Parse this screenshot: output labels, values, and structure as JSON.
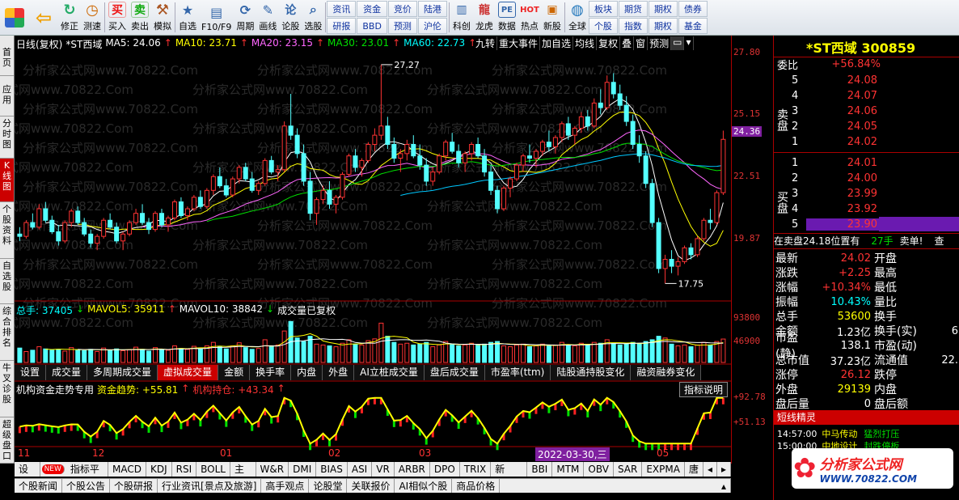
{
  "toolbar": {
    "items": [
      {
        "name": "home",
        "label": ""
      },
      {
        "name": "back",
        "label": ""
      },
      {
        "name": "fix",
        "label": "修正"
      },
      {
        "name": "test",
        "label": "测速"
      },
      {
        "name": "buy",
        "label": "买入",
        "glyph": "买"
      },
      {
        "name": "sell",
        "label": "卖出",
        "glyph": "卖"
      },
      {
        "name": "sim",
        "label": "模拟"
      },
      {
        "name": "self",
        "label": "自选"
      },
      {
        "name": "f10",
        "label": "F10/F9"
      },
      {
        "name": "period",
        "label": "周期"
      },
      {
        "name": "draw",
        "label": "画线"
      },
      {
        "name": "stock",
        "label": "论股"
      },
      {
        "name": "pick",
        "label": "选股"
      }
    ],
    "grid1": [
      "资讯",
      "研报",
      "资金",
      "BBD",
      "竞价",
      "预测",
      "陆港",
      "沪伦"
    ],
    "items2": [
      {
        "name": "kechuang",
        "label": "科创"
      },
      {
        "name": "longhu",
        "label": "龙虎"
      },
      {
        "name": "data",
        "label": "数据"
      },
      {
        "name": "hot",
        "label": "热点"
      },
      {
        "name": "newstock",
        "label": "新股"
      },
      {
        "name": "global",
        "label": "全球"
      }
    ],
    "grid2": [
      "板块",
      "个股",
      "期货",
      "指数",
      "期权",
      "期权",
      "债券",
      "基金"
    ]
  },
  "leftnav": [
    "首页",
    "应用",
    "分时图",
    "K线图",
    "个股资料",
    "自选股",
    "综合排名",
    "牛叉诊股",
    "超级盘口"
  ],
  "chart_header": {
    "period": "日线(复权)",
    "name": "*ST西域",
    "ma5": "MA5: 24.06",
    "ma10": "MA10: 23.71",
    "ma20": "MA20: 23.15",
    "ma30": "MA30: 23.01",
    "ma60": "MA60: 22.73",
    "buttons": [
      "九转",
      "重大事件",
      "加自选",
      "均线",
      "复权",
      "叠",
      "窗",
      "预测"
    ]
  },
  "price_axis": [
    "27.80",
    "25.15",
    "24.36",
    "22.51",
    "19.87"
  ],
  "price_high_label": "27.27",
  "price_low_label": "17.75",
  "volume_header": {
    "total": "总手: 37405",
    "mavol5": "MAVOL5: 35911",
    "mavol10": "MAVOL10: 38842",
    "note": "成交量已复权"
  },
  "volume_axis": [
    "93800",
    "46900"
  ],
  "subtabs": [
    "设置",
    "成交量",
    "多周期成交量",
    "虚拟成交量",
    "金额",
    "换手率",
    "内盘",
    "外盘",
    "AI立桩成交量",
    "盘后成交量",
    "市盈率(ttm)",
    "陆股通持股变化",
    "融资融券变化"
  ],
  "fund_header": {
    "title": "机构资金走势专用",
    "trend": "资金趋势: +55.81",
    "hold": "机构持仓: +43.34",
    "btn": "指标说明"
  },
  "fund_axis": [
    "+92.78",
    "+51.13"
  ],
  "x_axis": [
    "11",
    "12",
    "01",
    "02",
    "03",
    "2022-03-30,三",
    "05"
  ],
  "indicator_tabs": [
    "设置",
    "NEW",
    "指标平台",
    "MACD",
    "KDJ",
    "RSI",
    "BOLL",
    "主力",
    "W&R",
    "DMI",
    "BIAS",
    "ASI",
    "VR",
    "ARBR",
    "DPO",
    "TRIX",
    "新DMA",
    "BBI",
    "MTM",
    "OBV",
    "SAR",
    "EXPMA",
    "唐"
  ],
  "news_tabs": [
    "个股新闻",
    "个股公告",
    "个股研报",
    "行业资讯[景点及旅游]",
    "高手观点",
    "论股堂",
    "关联报价",
    "AI相似个股",
    "商品价格"
  ],
  "quote": {
    "title": "*ST西域 300859",
    "weibi_label": "委比",
    "weibi": "+56.84%",
    "sell_label": "卖盘",
    "buy_label": "买盘",
    "asks": [
      {
        "lvl": "5",
        "price": "24.08"
      },
      {
        "lvl": "4",
        "price": "24.07"
      },
      {
        "lvl": "3",
        "price": "24.06"
      },
      {
        "lvl": "2",
        "price": "24.05"
      },
      {
        "lvl": "1",
        "price": "24.02"
      }
    ],
    "bids": [
      {
        "lvl": "1",
        "price": "24.01"
      },
      {
        "lvl": "2",
        "price": "24.00"
      },
      {
        "lvl": "3",
        "price": "23.99"
      },
      {
        "lvl": "4",
        "price": "23.92"
      },
      {
        "lvl": "5",
        "price": "23.90"
      }
    ],
    "note": "在卖盘24.18位置有",
    "note_qty": "27手",
    "note_tag": "卖单!",
    "note_btn": "查",
    "stats": [
      {
        "l": "最新",
        "v": "24.02",
        "l2": "开盘"
      },
      {
        "l": "涨跌",
        "v": "+2.25",
        "l2": "最高"
      },
      {
        "l": "涨幅",
        "v": "+10.34%",
        "l2": "最低"
      },
      {
        "l": "振幅",
        "v": "10.43%",
        "l2": "量比"
      },
      {
        "l": "总手",
        "v": "53600",
        "l2": "换手"
      },
      {
        "l": "金额",
        "v": "1.23亿",
        "l2": "换手(实)"
      },
      {
        "l": "市盈(静)",
        "v": "138.1",
        "l2": "市盈(动)"
      },
      {
        "l": "总市值",
        "v": "37.23亿",
        "l2": "流通值"
      },
      {
        "l": "涨停",
        "v": "26.12",
        "l2": "跌停"
      },
      {
        "l": "外盘",
        "v": "29139",
        "l2": "内盘"
      },
      {
        "l": "盘后量",
        "v": "0",
        "l2": "盘后额"
      }
    ],
    "stats_right_tail": [
      "",
      "",
      "",
      "",
      "",
      "6",
      "",
      "22.",
      "",
      "",
      ""
    ],
    "sprite_title": "短线精灵",
    "sprites": [
      {
        "t": "14:57:00",
        "n": "中马传动",
        "e": "猛烈打压"
      },
      {
        "t": "15:00:00",
        "n": "中地设计",
        "e": "封跌停板"
      }
    ]
  },
  "watermark_text": "分析家公式网www.70822.Com",
  "brand": {
    "name": "分析家公式网",
    "url": "WWW.70822.COM"
  },
  "chart_data": {
    "type": "candlestick",
    "ylim": [
      17.2,
      27.9
    ],
    "candles": [
      [
        19.9,
        20.2,
        19.6,
        19.8
      ],
      [
        19.8,
        20.5,
        19.7,
        20.4
      ],
      [
        20.4,
        20.8,
        20.1,
        20.2
      ],
      [
        20.2,
        21.2,
        20.1,
        21.0
      ],
      [
        21.0,
        21.3,
        20.4,
        20.5
      ],
      [
        20.5,
        20.7,
        19.9,
        20.0
      ],
      [
        20.0,
        20.3,
        19.4,
        19.6
      ],
      [
        19.6,
        20.5,
        19.5,
        20.4
      ],
      [
        20.4,
        21.0,
        20.2,
        20.9
      ],
      [
        20.9,
        21.1,
        20.3,
        20.4
      ],
      [
        20.4,
        20.6,
        19.8,
        19.9
      ],
      [
        19.9,
        20.1,
        19.3,
        19.5
      ],
      [
        19.5,
        19.9,
        19.2,
        19.8
      ],
      [
        19.8,
        20.6,
        19.7,
        20.5
      ],
      [
        20.5,
        20.8,
        20.1,
        20.2
      ],
      [
        20.2,
        20.4,
        19.5,
        19.6
      ],
      [
        19.6,
        20.0,
        19.2,
        19.9
      ],
      [
        19.9,
        20.5,
        19.8,
        20.4
      ],
      [
        20.4,
        21.0,
        20.3,
        20.8
      ],
      [
        20.8,
        21.2,
        20.3,
        20.4
      ],
      [
        20.4,
        20.6,
        19.9,
        20.1
      ],
      [
        20.1,
        20.9,
        20.0,
        20.8
      ],
      [
        20.8,
        21.0,
        20.2,
        20.3
      ],
      [
        20.3,
        20.7,
        20.0,
        20.6
      ],
      [
        20.6,
        21.4,
        20.5,
        21.3
      ],
      [
        21.3,
        21.5,
        20.6,
        20.7
      ],
      [
        20.7,
        21.1,
        20.5,
        21.0
      ],
      [
        21.0,
        21.6,
        20.9,
        21.5
      ],
      [
        21.5,
        21.8,
        21.0,
        21.1
      ],
      [
        21.1,
        21.9,
        21.0,
        21.8
      ],
      [
        21.8,
        22.5,
        21.6,
        22.4
      ],
      [
        22.4,
        22.8,
        21.9,
        22.0
      ],
      [
        22.0,
        22.3,
        21.5,
        21.6
      ],
      [
        21.6,
        22.4,
        21.5,
        22.3
      ],
      [
        22.3,
        22.9,
        22.1,
        22.8
      ],
      [
        22.8,
        23.0,
        22.2,
        22.3
      ],
      [
        22.3,
        22.6,
        21.7,
        21.8
      ],
      [
        21.8,
        22.2,
        21.6,
        22.1
      ],
      [
        22.1,
        23.2,
        22.0,
        23.1
      ],
      [
        23.1,
        23.3,
        22.5,
        22.6
      ],
      [
        22.6,
        22.9,
        22.2,
        22.7
      ],
      [
        22.7,
        24.8,
        22.6,
        24.6
      ],
      [
        24.6,
        26.0,
        24.0,
        24.2
      ],
      [
        24.2,
        24.5,
        23.2,
        23.4
      ],
      [
        23.4,
        23.8,
        22.0,
        22.2
      ],
      [
        22.2,
        22.6,
        20.5,
        20.8
      ],
      [
        20.8,
        21.5,
        20.3,
        21.4
      ],
      [
        21.4,
        22.0,
        21.2,
        21.8
      ],
      [
        21.8,
        22.2,
        21.0,
        21.2
      ],
      [
        21.2,
        21.6,
        20.8,
        21.5
      ],
      [
        21.5,
        22.6,
        21.4,
        22.5
      ],
      [
        22.5,
        23.4,
        22.4,
        23.3
      ],
      [
        23.3,
        23.6,
        22.6,
        22.8
      ],
      [
        22.8,
        23.2,
        22.4,
        23.1
      ],
      [
        23.1,
        23.9,
        23.0,
        23.8
      ],
      [
        23.8,
        24.5,
        23.5,
        24.2
      ],
      [
        24.2,
        27.27,
        24.0,
        24.6
      ],
      [
        24.6,
        25.0,
        23.6,
        23.8
      ],
      [
        23.8,
        24.1,
        23.0,
        23.2
      ],
      [
        23.2,
        23.6,
        22.6,
        23.4
      ],
      [
        23.4,
        24.0,
        23.1,
        23.8
      ],
      [
        23.8,
        24.2,
        23.2,
        23.3
      ],
      [
        23.3,
        23.8,
        22.7,
        22.9
      ],
      [
        22.9,
        23.2,
        22.0,
        22.2
      ],
      [
        22.2,
        22.8,
        22.0,
        22.6
      ],
      [
        22.6,
        23.4,
        22.5,
        23.3
      ],
      [
        23.3,
        24.0,
        23.1,
        23.9
      ],
      [
        23.9,
        24.3,
        23.4,
        23.5
      ],
      [
        23.5,
        23.8,
        22.8,
        23.0
      ],
      [
        23.0,
        23.5,
        22.6,
        23.4
      ],
      [
        23.4,
        23.9,
        23.1,
        23.8
      ],
      [
        23.8,
        24.1,
        23.2,
        23.3
      ],
      [
        23.3,
        23.6,
        22.4,
        22.6
      ],
      [
        22.6,
        22.9,
        21.6,
        21.8
      ],
      [
        21.8,
        22.0,
        20.8,
        21.0
      ],
      [
        21.0,
        22.0,
        20.9,
        21.9
      ],
      [
        21.9,
        22.4,
        21.5,
        22.3
      ],
      [
        22.3,
        23.0,
        22.2,
        22.9
      ],
      [
        22.9,
        23.4,
        22.6,
        23.3
      ],
      [
        23.3,
        23.8,
        23.0,
        23.2
      ],
      [
        23.2,
        23.6,
        22.8,
        23.5
      ],
      [
        23.5,
        24.0,
        23.3,
        23.9
      ],
      [
        23.9,
        24.4,
        23.5,
        23.7
      ],
      [
        23.7,
        24.2,
        23.4,
        24.1
      ],
      [
        24.1,
        24.8,
        23.9,
        24.7
      ],
      [
        24.7,
        25.0,
        24.0,
        24.2
      ],
      [
        24.2,
        24.6,
        23.8,
        24.5
      ],
      [
        24.5,
        25.2,
        24.3,
        25.0
      ],
      [
        25.0,
        25.3,
        24.4,
        24.6
      ],
      [
        24.6,
        25.8,
        24.5,
        25.6
      ],
      [
        25.6,
        26.2,
        25.1,
        25.4
      ],
      [
        25.4,
        26.8,
        25.3,
        26.5
      ],
      [
        26.5,
        26.9,
        25.8,
        26.0
      ],
      [
        26.0,
        26.4,
        25.3,
        25.5
      ],
      [
        25.5,
        25.9,
        24.6,
        24.8
      ],
      [
        24.8,
        25.1,
        23.6,
        23.8
      ],
      [
        23.8,
        24.2,
        23.0,
        23.3
      ],
      [
        23.3,
        23.5,
        21.9,
        22.1
      ],
      [
        22.1,
        22.3,
        20.2,
        20.4
      ],
      [
        20.4,
        20.6,
        18.2,
        18.4
      ],
      [
        18.4,
        19.0,
        17.75,
        18.8
      ],
      [
        18.8,
        19.2,
        18.2,
        18.5
      ],
      [
        18.5,
        18.9,
        18.1,
        18.7
      ],
      [
        18.7,
        19.4,
        18.6,
        19.3
      ],
      [
        19.3,
        19.5,
        18.8,
        19.0
      ],
      [
        19.0,
        19.8,
        18.9,
        19.7
      ],
      [
        19.7,
        20.6,
        19.6,
        20.5
      ],
      [
        20.5,
        21.0,
        20.1,
        20.4
      ],
      [
        20.4,
        21.8,
        20.3,
        21.7
      ],
      [
        21.7,
        24.4,
        21.6,
        24.02
      ]
    ],
    "volume_ylim": [
      0,
      100000
    ],
    "volumes": [
      33000,
      25000,
      28000,
      36000,
      31000,
      28000,
      30000,
      26000,
      34000,
      29000,
      27000,
      30000,
      25000,
      33000,
      28000,
      31000,
      27000,
      29000,
      35000,
      30000,
      26000,
      34000,
      29000,
      28000,
      38000,
      32000,
      30000,
      37000,
      31000,
      38000,
      46000,
      36000,
      31000,
      38000,
      45000,
      34000,
      30000,
      32000,
      52000,
      38000,
      40000,
      72000,
      93800,
      56000,
      48000,
      60000,
      42000,
      40000,
      38000,
      36000,
      44000,
      52000,
      42000,
      40000,
      50000,
      54000,
      90000,
      60000,
      46000,
      42000,
      44000,
      40000,
      42000,
      46000,
      36000,
      40000,
      48000,
      42000,
      38000,
      40000,
      44000,
      40000,
      42000,
      46000,
      48000,
      38000,
      36000,
      40000,
      42000,
      36000,
      38000,
      42000,
      38000,
      40000,
      46000,
      40000,
      38000,
      44000,
      40000,
      46000,
      44000,
      52000,
      44000,
      40000,
      42000,
      46000,
      44000,
      48000,
      52000,
      60000,
      56000,
      42000,
      38000,
      40000,
      36000,
      40000,
      46000,
      40000,
      48000,
      53600
    ],
    "fund_ylim": [
      30,
      100
    ]
  }
}
